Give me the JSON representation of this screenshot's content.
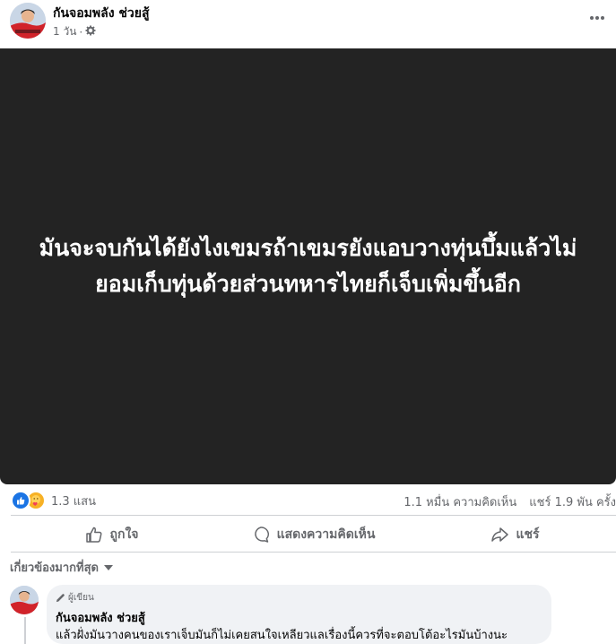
{
  "post": {
    "page_name": "กันจอมพลัง ช่วยสู้",
    "time": "1 วัน",
    "separator": "·",
    "privacy_icon": "gear-icon",
    "more_icon": "more-dots-icon",
    "body_text": "มันจะจบกันได้ยังไงเขมรถ้าเขมรยังแอบวางทุ่นบึ้มแล้วไม่ยอมเก็บทุ่นด้วยส่วนทหารไทยก็เจ็บเพิ่มขึ้นอีก",
    "background_color": "#232323"
  },
  "stats": {
    "reaction_icons": [
      "like-icon",
      "care-icon"
    ],
    "reactions": "1.3 แสน",
    "comments": "1.1 หมื่น ความคิดเห็น",
    "shares": "แชร์ 1.9 พัน ครั้ง"
  },
  "actions": {
    "like": "ถูกใจ",
    "comment": "แสดงความคิดเห็น",
    "share": "แชร์"
  },
  "sort": {
    "label": "เกี่ยวข้องมากที่สุด"
  },
  "comment": {
    "badge": "ผู้เขียน",
    "author": "กันจอมพลัง ช่วยสู้",
    "text": "แล้วฝั่งมันวางคนของเราเจ็บมันก็ไม่เคยสนใจเหลียวแลเรื่องนี้ควรที่จะตอบโต้อะไรมันบ้างนะ"
  },
  "colors": {
    "accent": "#1b74e4",
    "muted_text": "#65676b"
  }
}
